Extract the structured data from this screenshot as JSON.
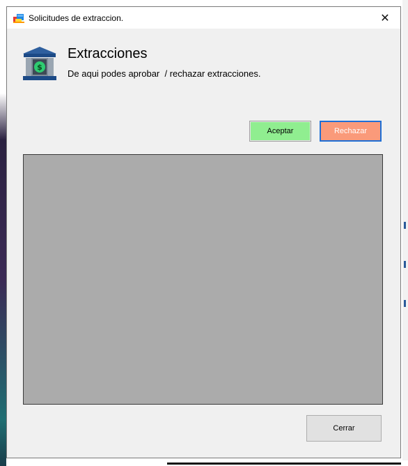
{
  "window": {
    "title": "Solicitudes de extraccion.",
    "close_glyph": "✕"
  },
  "header": {
    "title": "Extracciones",
    "subtitle": "De aqui podes aprobar  / rechazar extracciones.",
    "icon": "bank-money-icon"
  },
  "actions": {
    "accept_label": "Aceptar",
    "reject_label": "Rechazar"
  },
  "footer": {
    "close_label": "Cerrar"
  },
  "colors": {
    "accept_bg": "#90ee90",
    "reject_bg": "#fa9a7a",
    "focus_border": "#1e6fd6",
    "grid_bg": "#ababab"
  }
}
